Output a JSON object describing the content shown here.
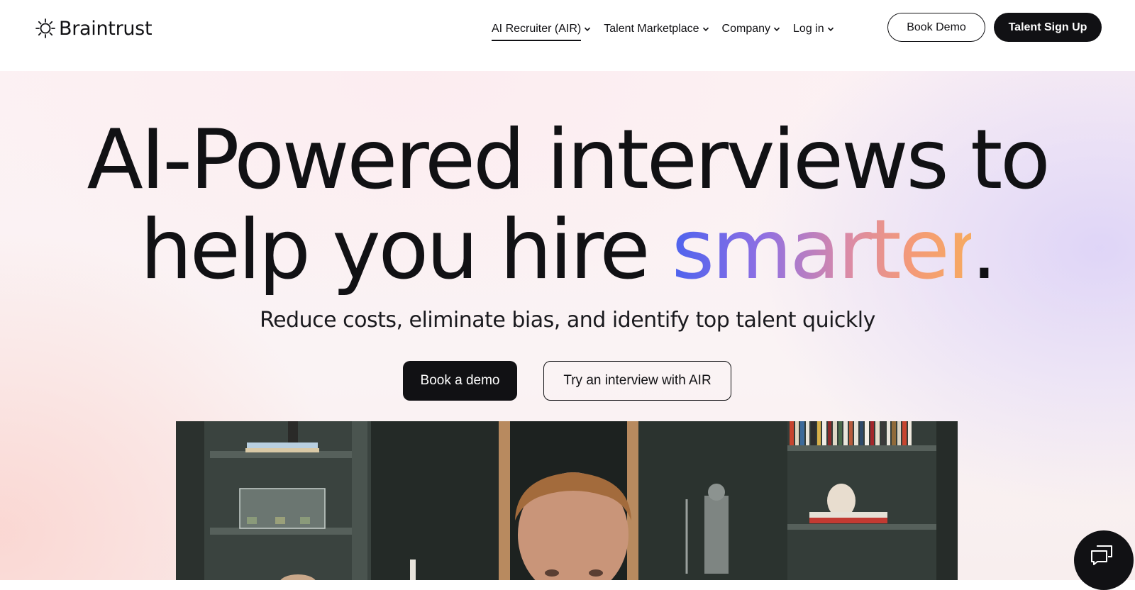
{
  "header": {
    "logo_text": "Braintrust",
    "nav": [
      {
        "label": "AI Recruiter (AIR)",
        "active": true
      },
      {
        "label": "Talent Marketplace",
        "active": false
      },
      {
        "label": "Company",
        "active": false
      },
      {
        "label": "Log in",
        "active": false
      }
    ],
    "book_demo_label": "Book Demo",
    "talent_signup_label": "Talent Sign Up"
  },
  "hero": {
    "headline_line1": "AI-Powered interviews to",
    "headline_line2_prefix": "help you hire ",
    "headline_highlight": "smarter",
    "headline_suffix": ".",
    "subheadline": "Reduce costs, eliminate bias, and identify top talent quickly",
    "primary_cta": "Book a demo",
    "secondary_cta": "Try an interview with AIR"
  },
  "icons": {
    "logo": "sun-gear-icon",
    "nav_dropdown": "chevron-down-icon",
    "chat": "chat-bubbles-icon"
  },
  "colors": {
    "ink": "#111114",
    "highlight_gradient": [
      "#4d63ee",
      "#8e6fe3",
      "#d98aa8",
      "#f49a78",
      "#f6aa60"
    ]
  }
}
